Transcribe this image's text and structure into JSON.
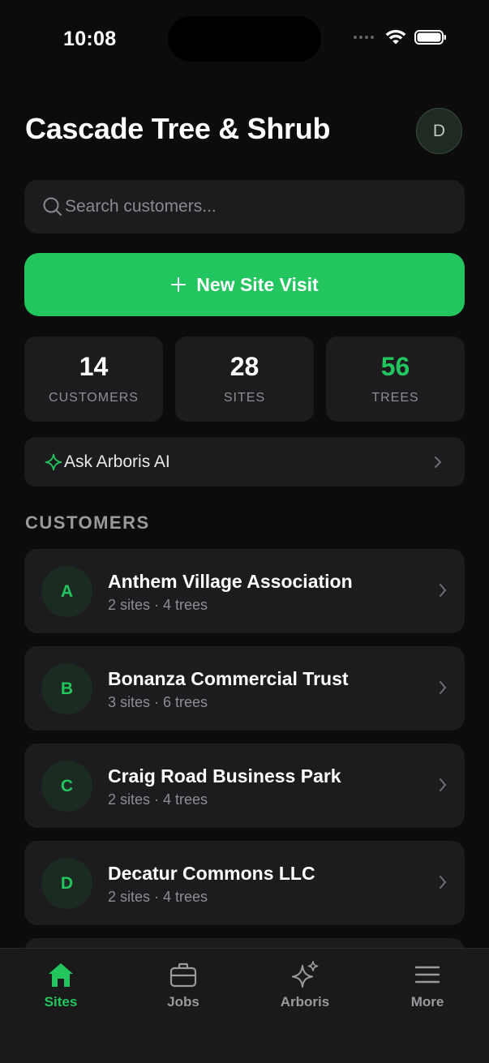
{
  "status_bar": {
    "time": "10:08"
  },
  "header": {
    "title": "Cascade Tree & Shrub",
    "avatar_initial": "D"
  },
  "search": {
    "placeholder": "Search customers...",
    "value": ""
  },
  "primary_action": {
    "label": "New Site Visit"
  },
  "stats": [
    {
      "value": "14",
      "label": "CUSTOMERS"
    },
    {
      "value": "28",
      "label": "SITES"
    },
    {
      "value": "56",
      "label": "TREES"
    }
  ],
  "ai_prompt": {
    "label": "Ask Arboris AI"
  },
  "customers_section": {
    "title": "CUSTOMERS",
    "items": [
      {
        "initial": "A",
        "name": "Anthem Village Association",
        "meta": "2 sites · 4 trees"
      },
      {
        "initial": "B",
        "name": "Bonanza Commercial Trust",
        "meta": "3 sites · 6 trees"
      },
      {
        "initial": "C",
        "name": "Craig Road Business Park",
        "meta": "2 sites · 4 trees"
      },
      {
        "initial": "D",
        "name": "Decatur Commons LLC",
        "meta": "2 sites · 4 trees"
      }
    ]
  },
  "tab_bar": {
    "tabs": [
      {
        "label": "Sites",
        "icon": "home-icon",
        "active": true
      },
      {
        "label": "Jobs",
        "icon": "briefcase-icon",
        "active": false
      },
      {
        "label": "Arboris",
        "icon": "sparkles-icon",
        "active": false
      },
      {
        "label": "More",
        "icon": "menu-icon",
        "active": false
      }
    ]
  },
  "colors": {
    "accent": "#22c55e",
    "background": "#0c0c0c",
    "card": "#1c1c1e",
    "muted": "#8e8e93"
  }
}
